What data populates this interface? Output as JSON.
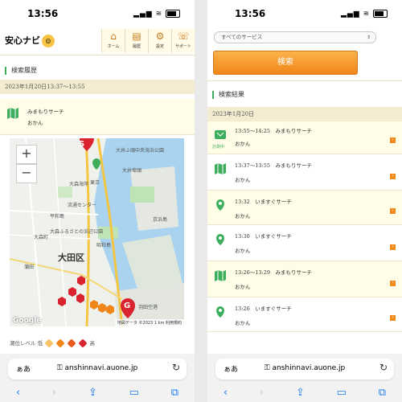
{
  "status": {
    "time": "13:56",
    "signal": "•••",
    "wifi": "≋"
  },
  "app": {
    "logo": "安心ナビ",
    "nav": [
      {
        "label": "ホーム",
        "icon": "house-icon"
      },
      {
        "label": "履歴",
        "icon": "history-icon"
      },
      {
        "label": "設定",
        "icon": "gear-icon"
      },
      {
        "label": "サポート",
        "icon": "support-icon"
      }
    ]
  },
  "left": {
    "section_title": "検索履歴",
    "datetime_range": "2023年1月20日13:37〜13:55",
    "entry": {
      "title": "みまもりサーチ",
      "name": "おかん"
    },
    "map": {
      "zoom_in": "+",
      "zoom_out": "−",
      "start_marker": "S",
      "goal_marker": "G",
      "labels": [
        "大田区",
        "大森海岸",
        "大森町",
        "平和島",
        "流通センター",
        "昭和島",
        "蒲田",
        "大森ふるさとの浜辺公園",
        "京浜島",
        "羽田空港",
        "東京",
        "大井埠頭",
        "大井ふ頭中央海浜公園"
      ],
      "attribution": "地図データ ©2023",
      "scale": "1 km",
      "terms": "利用規約",
      "google": "Google"
    },
    "legend": {
      "label": "潮位レベル 低",
      "high": "高"
    }
  },
  "right": {
    "service_select": "すべてのサービス",
    "search_button": "検索",
    "section_title": "検索結果",
    "date": "2023年1月20日",
    "results": [
      {
        "time": "13:55〜14:25",
        "service": "みまもりサーチ",
        "name": "おかん",
        "icon": "measuring-icon",
        "badge": "計測中"
      },
      {
        "time": "13:37〜13:55",
        "service": "みまもりサーチ",
        "name": "おかん",
        "icon": "map-icon"
      },
      {
        "time": "13:32",
        "service": "いますぐサーチ",
        "name": "おかん",
        "icon": "pin-icon"
      },
      {
        "time": "13:30",
        "service": "いますぐサーチ",
        "name": "おかん",
        "icon": "pin-icon"
      },
      {
        "time": "13:26〜13:29",
        "service": "みまもりサーチ",
        "name": "おかん",
        "icon": "map-icon"
      },
      {
        "time": "13:26",
        "service": "いますぐサーチ",
        "name": "おかん",
        "icon": "pin-icon"
      }
    ]
  },
  "browser": {
    "aa": "ぁあ",
    "url": "anshinnavi.auone.jp",
    "lock": "🔒"
  },
  "colors": {
    "accent_orange": "#f08619",
    "green": "#3cae5c",
    "entry_bg": "#fffce7",
    "date_band": "#f4ecd0"
  }
}
